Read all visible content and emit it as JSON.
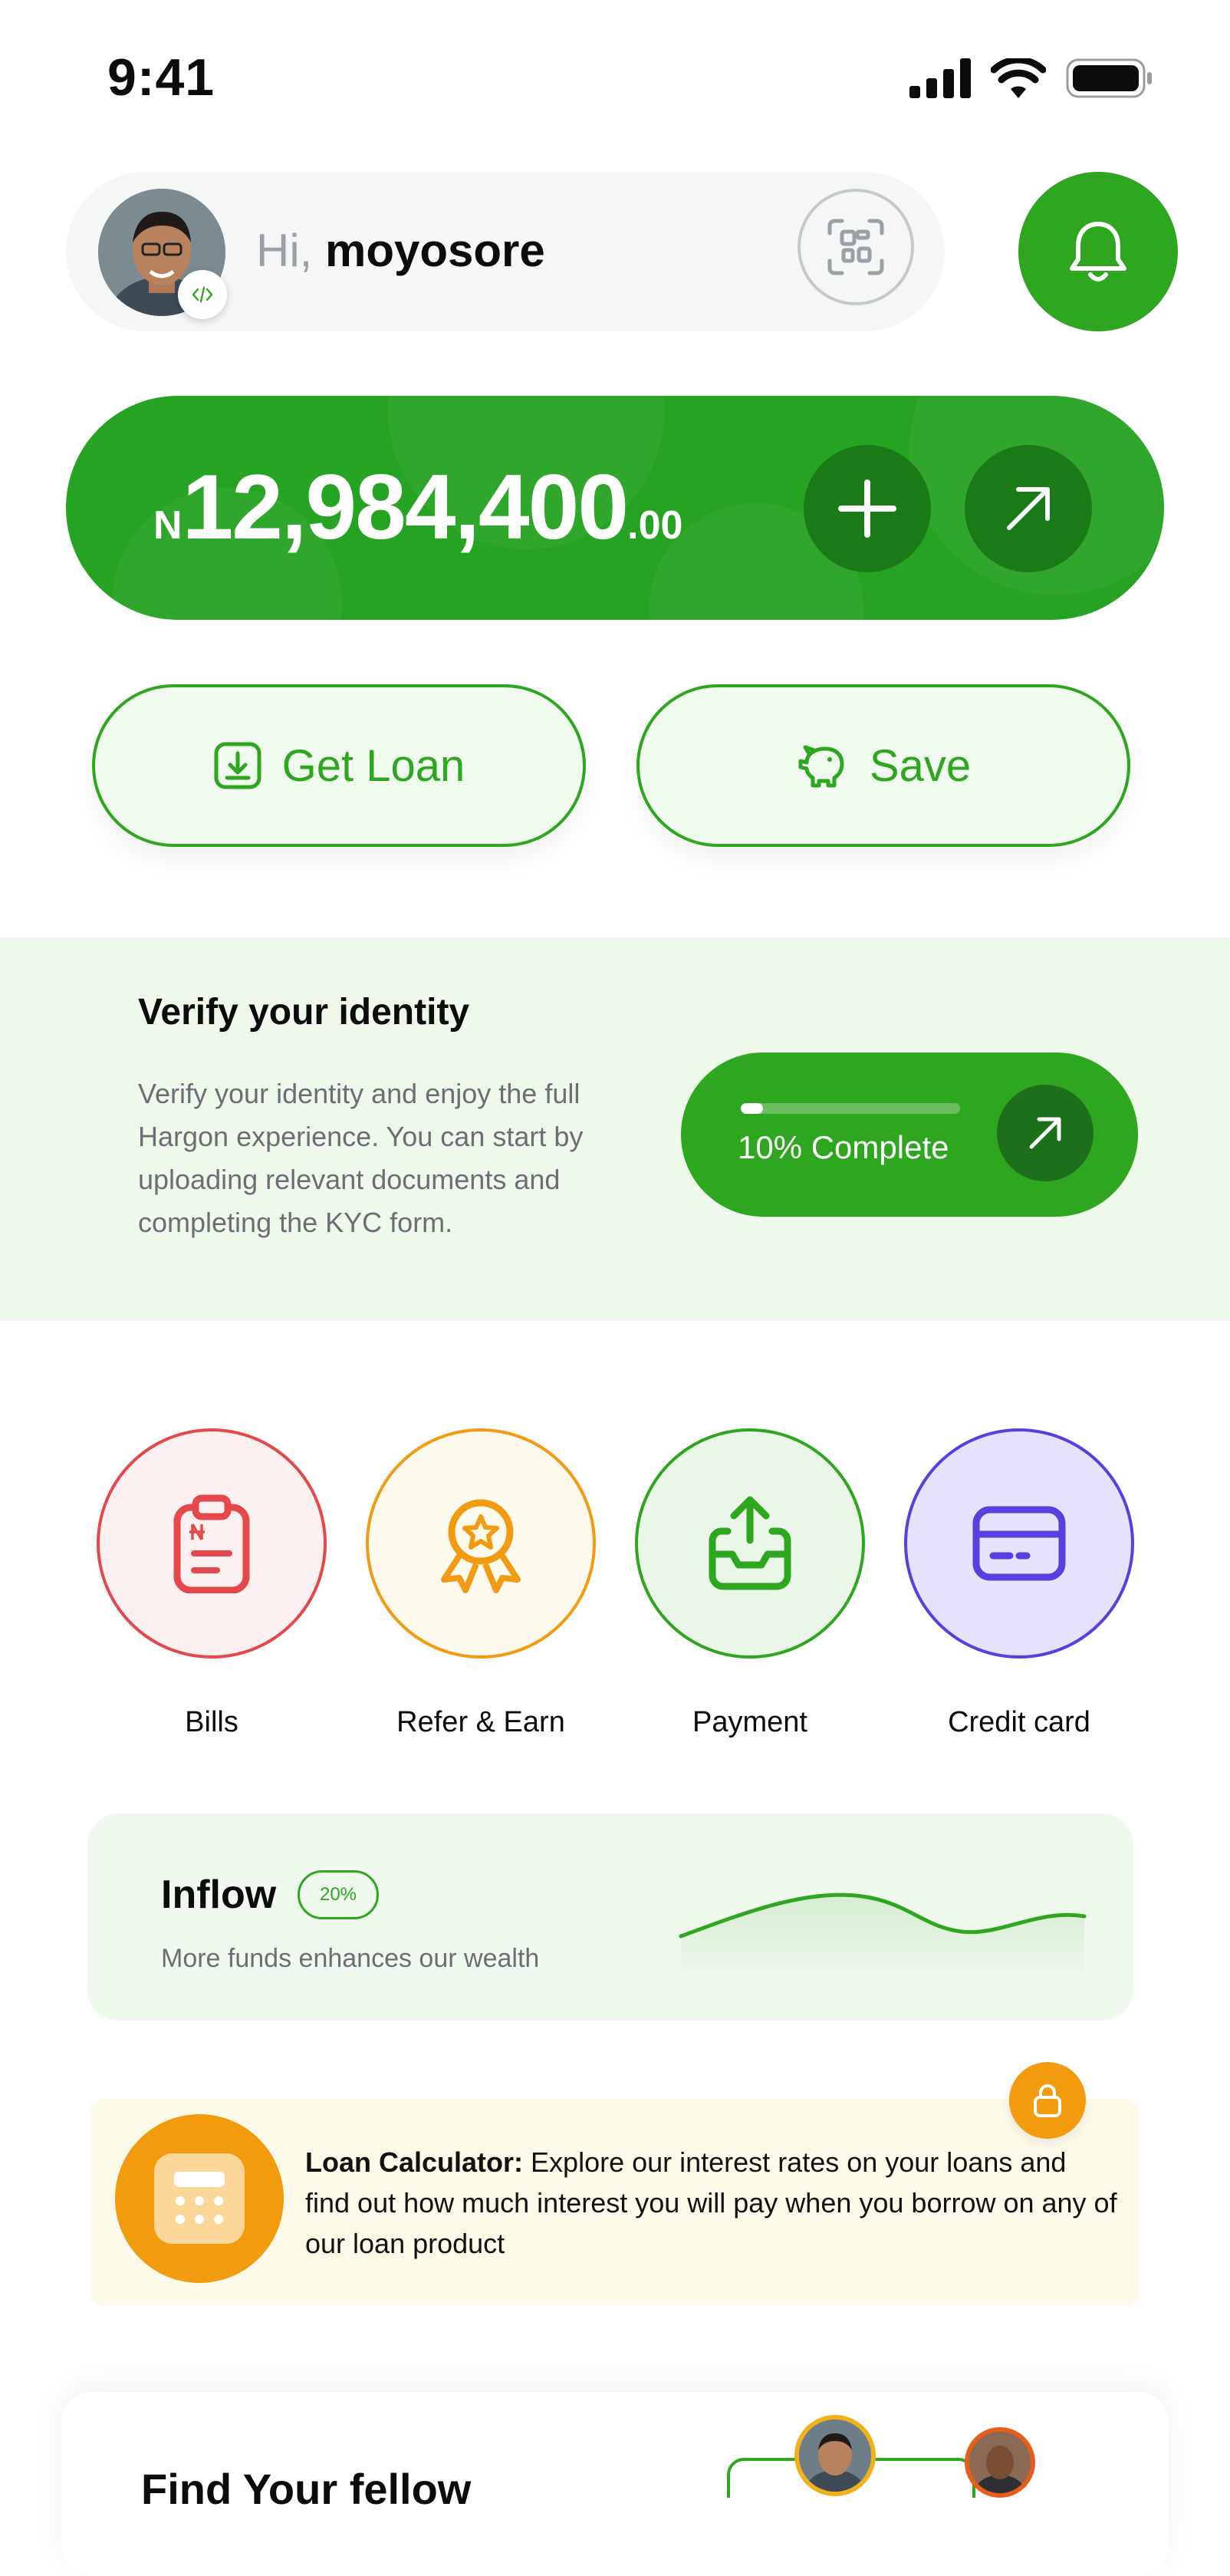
{
  "status_bar": {
    "time": "9:41"
  },
  "header": {
    "greeting": "Hi,",
    "username": "moyosore"
  },
  "balance": {
    "currency": "N",
    "amount": "12,984,400",
    "decimals": ".00"
  },
  "actions": {
    "get_loan": "Get Loan",
    "save": "Save"
  },
  "verify": {
    "title": "Verify your identity",
    "description": "Verify your identity and enjoy the full Hargon experience. You can start by uploading relevant documents and completing the KYC form.",
    "progress_label": "10% Complete",
    "progress": 0.1
  },
  "shortcuts": [
    {
      "label": "Bills",
      "icon": "clipboard-naira-icon",
      "color": "#e4484a",
      "bg": "#fdf0f0"
    },
    {
      "label": "Refer & Earn",
      "icon": "award-ribbon-icon",
      "color": "#f29b12",
      "bg": "#fefbee"
    },
    {
      "label": "Payment",
      "icon": "tray-upload-icon",
      "color": "#2ea620",
      "bg": "#eaf7e8"
    },
    {
      "label": "Credit card",
      "icon": "credit-card-icon",
      "color": "#5a3fe0",
      "bg": "#e4e2fc"
    }
  ],
  "inflow": {
    "title": "Inflow",
    "badge": "20%",
    "subtitle": "More funds enhances our wealth"
  },
  "loan_calculator": {
    "title": "Loan Calculator:",
    "text": " Explore our interest rates on your loans and find out how much interest you will pay when you   borrow on any of our loan product"
  },
  "follow": {
    "title": "Find Your fellow"
  },
  "colors": {
    "brand_green": "#2ea620",
    "dark_green": "#1b7a18",
    "orange": "#f39b0f"
  }
}
